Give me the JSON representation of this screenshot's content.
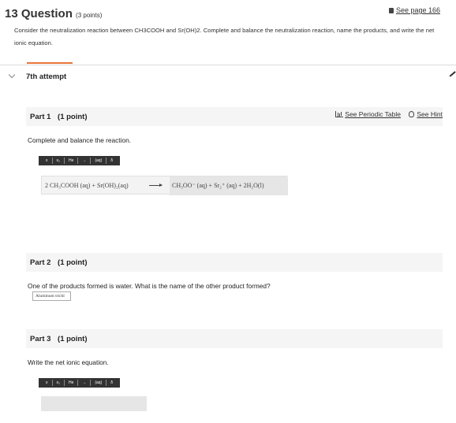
{
  "question": {
    "number": "13",
    "label": "Question",
    "points": "(3 points)",
    "see_page": "See page 166",
    "description": "Consider the neutralization reaction between CH3COOH and Sr(OH)2. Complete and balance the neutralization reaction, name the products, and write the net ionic equation."
  },
  "attempt": {
    "label": "7th attempt"
  },
  "tools": {
    "periodic_table": "See Periodic Table",
    "hint": "See Hint"
  },
  "toolbar_buttons": [
    "x",
    "x₂",
    "He",
    "→",
    "(aq)",
    "δ"
  ],
  "part1": {
    "label": "Part 1",
    "points": "(1 point)",
    "prompt": "Complete and balance the reaction.",
    "equation_left": "2 CH₃COOH (aq) + Sr(OH)₂(aq)",
    "equation_right": "CH₃OO⁻ (aq) + Sr₂⁺ (aq) + 2H₂O(l)"
  },
  "part2": {
    "label": "Part 2",
    "points": "(1 point)",
    "prompt": "One of the products formed is water. What is the name of the other product formed?",
    "answer_value": "Aluminum trichl"
  },
  "part3": {
    "label": "Part 3",
    "points": "(1 point)",
    "prompt": "Write the net ionic equation."
  }
}
